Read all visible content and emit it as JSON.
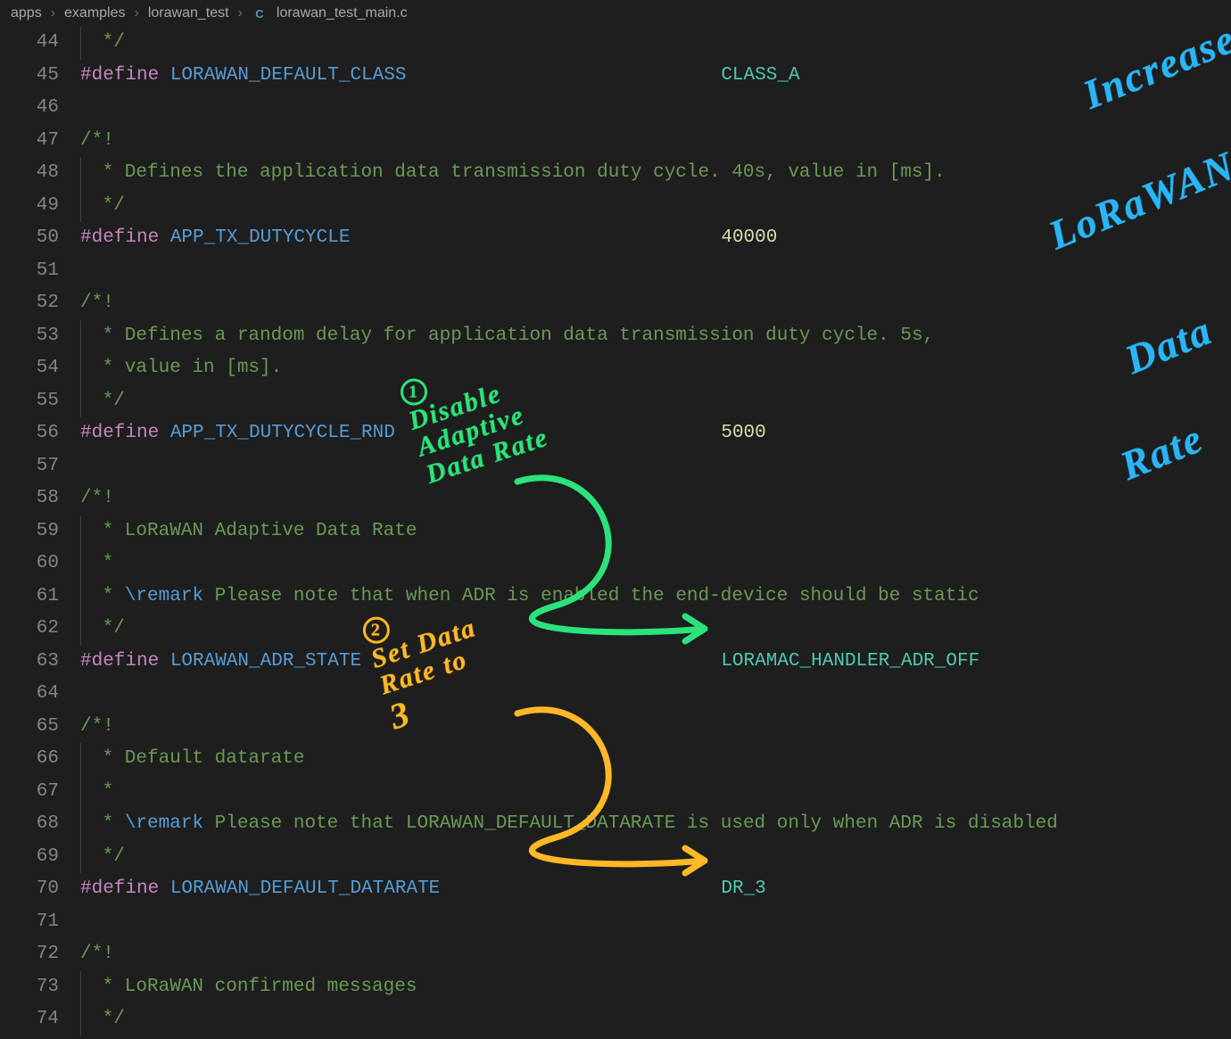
{
  "breadcrumb": {
    "seg0": "apps",
    "seg1": "examples",
    "seg2": "lorawan_test",
    "file_icon_letter": "C",
    "file": "lorawan_test_main.c"
  },
  "lines": {
    "n44": "44",
    "n45": "45",
    "n46": "46",
    "n47": "47",
    "n48": "48",
    "n49": "49",
    "n50": "50",
    "n51": "51",
    "n52": "52",
    "n53": "53",
    "n54": "54",
    "n55": "55",
    "n56": "56",
    "n57": "57",
    "n58": "58",
    "n59": "59",
    "n60": "60",
    "n61": "61",
    "n62": "62",
    "n63": "63",
    "n64": "64",
    "n65": "65",
    "n66": "66",
    "n67": "67",
    "n68": "68",
    "n69": "69",
    "n70": "70",
    "n71": "71",
    "n72": "72",
    "n73": "73",
    "n74": "74"
  },
  "tok": {
    "define": "#define",
    "block_open": "/*!",
    "block_mid": " *",
    "block_close": " */",
    "remark": "\\remark",
    "class_macro": " LORAWAN_DEFAULT_CLASS",
    "class_pad": "                            ",
    "class_value": "CLASS_A",
    "duty_c1": " * Defines the application data transmission duty cycle. 40s, value in [ms].",
    "duty_macro": " APP_TX_DUTYCYCLE",
    "duty_pad": "                                 ",
    "duty_value": "40000",
    "rnd_c1": " * Defines a random delay for application data transmission duty cycle. 5s,",
    "rnd_c2": " * value in [ms].",
    "rnd_macro": " APP_TX_DUTYCYCLE_RND",
    "rnd_pad": "                             ",
    "rnd_value": "5000",
    "adr_c1": " * LoRaWAN Adaptive Data Rate",
    "adr_c3": " Please note that when ADR is enabled the end-device should be static",
    "adr_macro": " LORAWAN_ADR_STATE",
    "adr_pad": "                                ",
    "adr_value": "LORAMAC_HANDLER_ADR_OFF",
    "dr_c1": " * Default datarate",
    "dr_c3": " Please note that LORAWAN_DEFAULT_DATARATE is used only when ADR is disabled",
    "dr_macro": " LORAWAN_DEFAULT_DATARATE",
    "dr_pad": "                         ",
    "dr_value": "DR_3",
    "conf_c1": " * LoRaWAN confirmed messages",
    "conf_close": " */"
  },
  "annotations": {
    "blue_w1": "Increase",
    "blue_w2": "LoRaWAN",
    "blue_w3": "Data",
    "blue_w4": "Rate",
    "green_num": "1",
    "green_l1": "Disable",
    "green_l2": "Adaptive",
    "green_l3": "Data Rate",
    "orange_num": "2",
    "orange_l1": "Set Data",
    "orange_l2": "Rate to",
    "orange_l3": "3"
  },
  "colors": {
    "ink_blue": "#29b6f6",
    "ink_green": "#2be37a",
    "ink_orange": "#fdb827"
  }
}
